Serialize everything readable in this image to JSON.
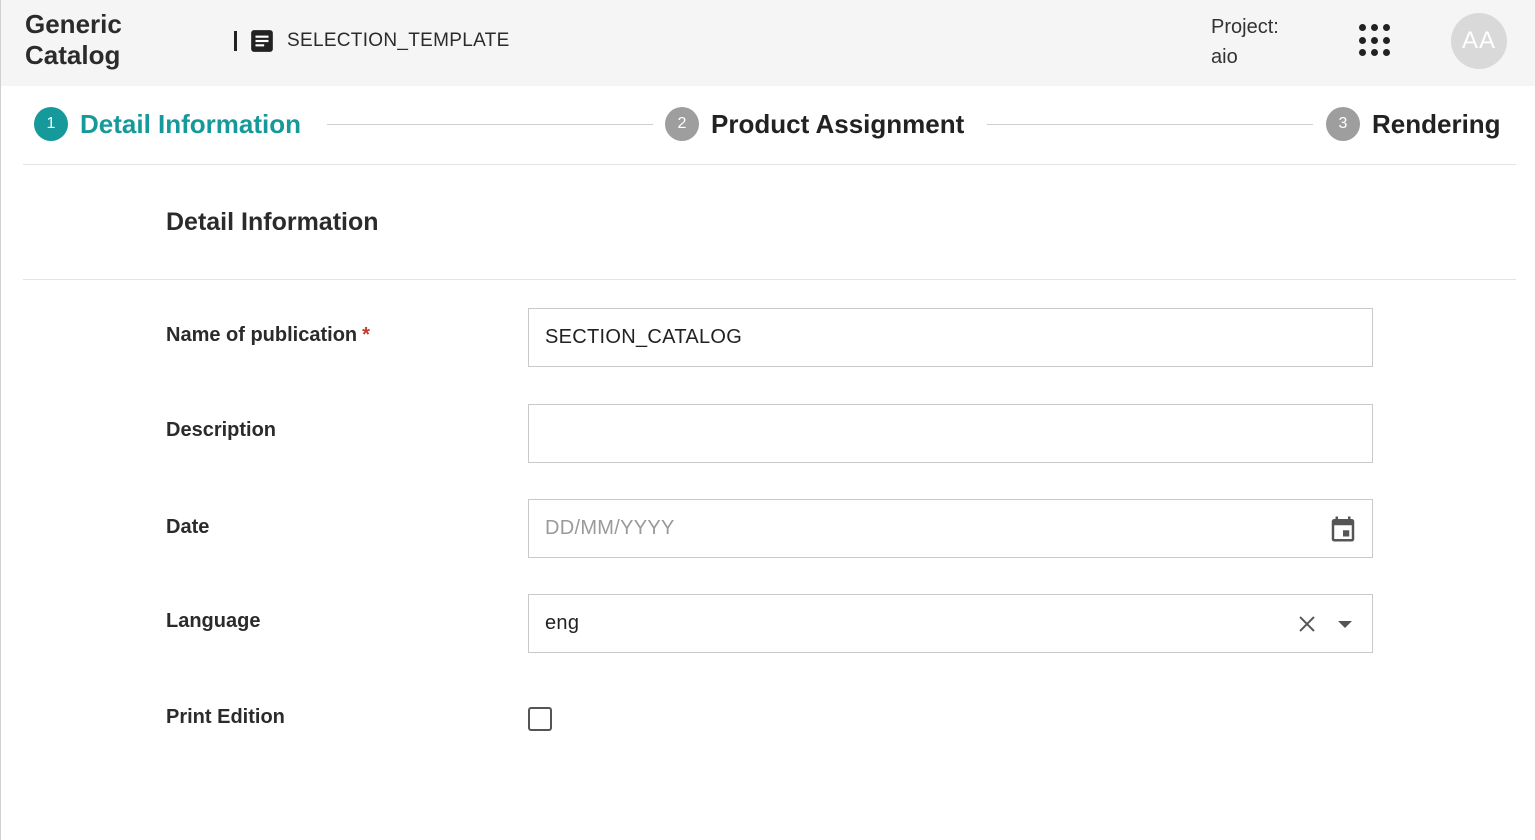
{
  "header": {
    "app_title": "Generic Catalog",
    "breadcrumb": "SELECTION_TEMPLATE",
    "project_label": "Project:",
    "project_value": "aio",
    "avatar_initials": "AA"
  },
  "stepper": {
    "steps": [
      {
        "number": "1",
        "label": "Detail Information",
        "active": true
      },
      {
        "number": "2",
        "label": "Product Assignment",
        "active": false
      },
      {
        "number": "3",
        "label": "Rendering",
        "active": false
      }
    ],
    "active_color": "#15999b",
    "inactive_color": "#9e9e9e"
  },
  "section": {
    "title": "Detail Information"
  },
  "form": {
    "name": {
      "label": "Name of publication",
      "required_mark": "*",
      "value": "SECTION_CATALOG"
    },
    "description": {
      "label": "Description",
      "value": ""
    },
    "date": {
      "label": "Date",
      "placeholder": "DD/MM/YYYY"
    },
    "language": {
      "label": "Language",
      "value": "eng"
    },
    "print_edition": {
      "label": "Print Edition",
      "checked": false
    }
  },
  "icons": {
    "breadcrumb": "document-icon",
    "apps": "apps-grid-icon",
    "date": "calendar-icon",
    "clear": "close-icon",
    "dropdown": "caret-down-icon"
  }
}
